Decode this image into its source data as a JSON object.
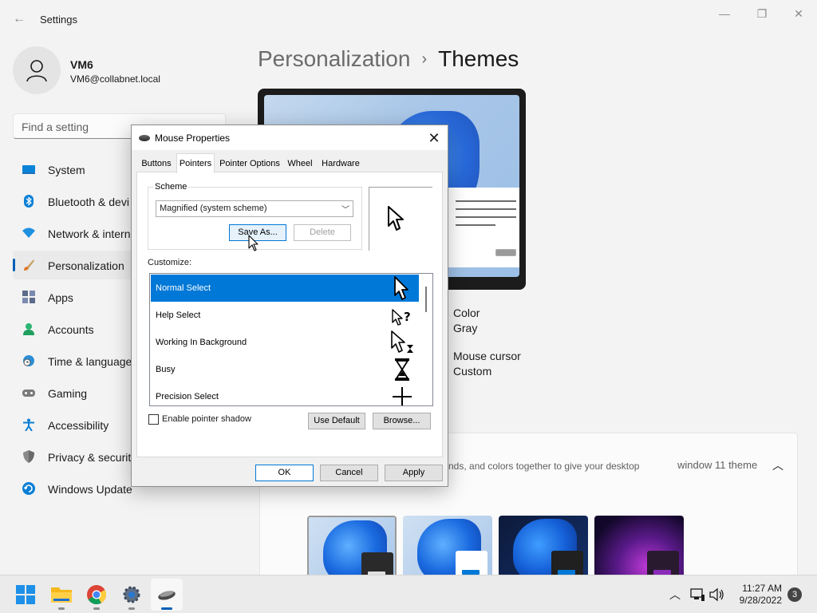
{
  "window": {
    "title": "Settings",
    "back_icon": "arrow-left-icon",
    "controls": [
      "minimize-icon",
      "restore-icon",
      "close-icon"
    ]
  },
  "profile": {
    "name": "VM6",
    "email": "VM6@collabnet.local"
  },
  "search": {
    "placeholder": "Find a setting"
  },
  "nav": {
    "items": [
      {
        "label": "System",
        "icon": "monitor-icon"
      },
      {
        "label": "Bluetooth & devi",
        "icon": "bluetooth-icon"
      },
      {
        "label": "Network & intern",
        "icon": "wifi-icon"
      },
      {
        "label": "Personalization",
        "icon": "brush-icon",
        "active": true
      },
      {
        "label": "Apps",
        "icon": "apps-icon"
      },
      {
        "label": "Accounts",
        "icon": "person-icon"
      },
      {
        "label": "Time & language",
        "icon": "globe-clock-icon"
      },
      {
        "label": "Gaming",
        "icon": "gamepad-icon"
      },
      {
        "label": "Accessibility",
        "icon": "accessibility-icon"
      },
      {
        "label": "Privacy & security",
        "icon": "shield-icon"
      },
      {
        "label": "Windows Update",
        "icon": "refresh-icon"
      }
    ]
  },
  "breadcrumb": {
    "parent": "Personalization",
    "separator": "›",
    "current": "Themes"
  },
  "theme_info": {
    "color_label": "Color",
    "color_value": "Gray",
    "cursor_label": "Mouse cursor",
    "cursor_value": "Custom"
  },
  "themes_card": {
    "description": "nds, and colors together to give your desktop",
    "current_theme": "window 11 theme",
    "chevron_icon": "chevron-up-icon"
  },
  "dialog": {
    "title": "Mouse Properties",
    "tabs": [
      "Buttons",
      "Pointers",
      "Pointer Options",
      "Wheel",
      "Hardware"
    ],
    "active_tab": "Pointers",
    "scheme_legend": "Scheme",
    "scheme_value": "Magnified (system scheme)",
    "save_as_label": "Save As...",
    "delete_label": "Delete",
    "customize_label": "Customize:",
    "cursors": [
      {
        "label": "Normal Select",
        "glyph": "arrow-cursor-icon",
        "selected": true
      },
      {
        "label": "Help Select",
        "glyph": "help-cursor-icon"
      },
      {
        "label": "Working In Background",
        "glyph": "busy-arrow-cursor-icon"
      },
      {
        "label": "Busy",
        "glyph": "hourglass-cursor-icon"
      },
      {
        "label": "Precision Select",
        "glyph": "crosshair-cursor-icon"
      }
    ],
    "shadow_label": "Enable pointer shadow",
    "shadow_checked": false,
    "use_default_label": "Use Default",
    "browse_label": "Browse...",
    "ok_label": "OK",
    "cancel_label": "Cancel",
    "apply_label": "Apply"
  },
  "taskbar": {
    "apps": [
      "windows-start-icon",
      "file-explorer-icon",
      "chrome-icon",
      "settings-gear-icon",
      "mouse-properties-icon"
    ],
    "tray_icons": [
      "chevron-up-icon",
      "network-icon",
      "volume-icon"
    ],
    "time": "11:27 AM",
    "date": "9/28/2022",
    "notifications": "3"
  },
  "colors": {
    "accent": "#005fb8",
    "selection": "#0078d7"
  }
}
